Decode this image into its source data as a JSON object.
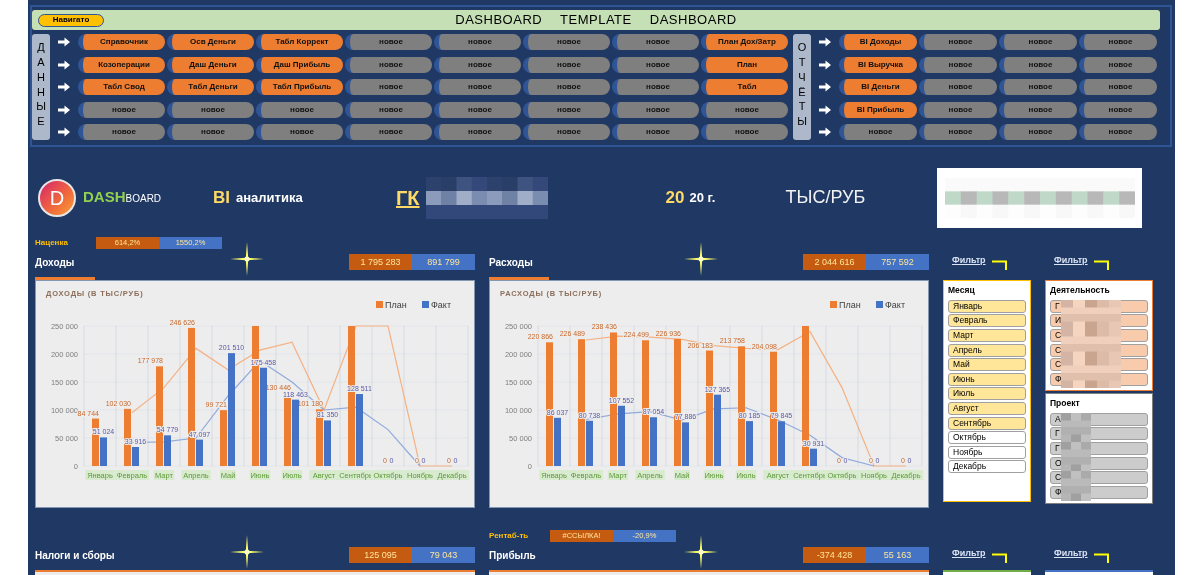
{
  "navigation": {
    "navigator_button": "Навигато",
    "title": "DASHBOARD TEMPLATE DASHBOARD",
    "groups": [
      {
        "label": "ДАННЫЕ",
        "rows": [
          [
            {
              "label": "Справочник",
              "highlighted": true
            },
            {
              "label": "Осв Деньги",
              "highlighted": true
            },
            {
              "label": "Табл Коррект",
              "highlighted": true
            },
            {
              "label": "новое",
              "highlighted": false
            },
            {
              "label": "новое",
              "highlighted": false
            },
            {
              "label": "новое",
              "highlighted": false
            },
            {
              "label": "новое",
              "highlighted": false
            },
            {
              "label": "План Дох/Затр",
              "highlighted": true
            }
          ],
          [
            {
              "label": "Козоперации",
              "highlighted": true
            },
            {
              "label": "Даш Деньги",
              "highlighted": true
            },
            {
              "label": "Даш Прибыль",
              "highlighted": true
            },
            {
              "label": "новое",
              "highlighted": false
            },
            {
              "label": "новое",
              "highlighted": false
            },
            {
              "label": "новое",
              "highlighted": false
            },
            {
              "label": "новое",
              "highlighted": false
            },
            {
              "label": "План",
              "highlighted": true
            }
          ],
          [
            {
              "label": "Табл Свод",
              "highlighted": true
            },
            {
              "label": "Табл Деньги",
              "highlighted": true
            },
            {
              "label": "Табл Прибыль",
              "highlighted": true
            },
            {
              "label": "новое",
              "highlighted": false
            },
            {
              "label": "новое",
              "highlighted": false
            },
            {
              "label": "новое",
              "highlighted": false
            },
            {
              "label": "новое",
              "highlighted": false
            },
            {
              "label": "Табл",
              "highlighted": true
            }
          ],
          [
            {
              "label": "новое",
              "highlighted": false
            },
            {
              "label": "новое",
              "highlighted": false
            },
            {
              "label": "новое",
              "highlighted": false
            },
            {
              "label": "новое",
              "highlighted": false
            },
            {
              "label": "новое",
              "highlighted": false
            },
            {
              "label": "новое",
              "highlighted": false
            },
            {
              "label": "новое",
              "highlighted": false
            },
            {
              "label": "новое",
              "highlighted": false
            }
          ],
          [
            {
              "label": "новое",
              "highlighted": false
            },
            {
              "label": "новое",
              "highlighted": false
            },
            {
              "label": "новое",
              "highlighted": false
            },
            {
              "label": "новое",
              "highlighted": false
            },
            {
              "label": "новое",
              "highlighted": false
            },
            {
              "label": "новое",
              "highlighted": false
            },
            {
              "label": "новое",
              "highlighted": false
            },
            {
              "label": "новое",
              "highlighted": false
            }
          ]
        ]
      },
      {
        "label": "ОТЧЁТЫ",
        "rows": [
          [
            {
              "label": "BI Доходы",
              "highlighted": true
            },
            {
              "label": "новое",
              "highlighted": false
            },
            {
              "label": "новое",
              "highlighted": false
            },
            {
              "label": "новое",
              "highlighted": false
            }
          ],
          [
            {
              "label": "BI Выручка",
              "highlighted": true
            },
            {
              "label": "новое",
              "highlighted": false
            },
            {
              "label": "новое",
              "highlighted": false
            },
            {
              "label": "новое",
              "highlighted": false
            }
          ],
          [
            {
              "label": "BI Деньги",
              "highlighted": true
            },
            {
              "label": "новое",
              "highlighted": false
            },
            {
              "label": "новое",
              "highlighted": false
            },
            {
              "label": "новое",
              "highlighted": false
            }
          ],
          [
            {
              "label": "BI Прибыль",
              "highlighted": true
            },
            {
              "label": "новое",
              "highlighted": false
            },
            {
              "label": "новое",
              "highlighted": false
            },
            {
              "label": "новое",
              "highlighted": false
            }
          ],
          [
            {
              "label": "новое",
              "highlighted": false
            },
            {
              "label": "новое",
              "highlighted": false
            },
            {
              "label": "новое",
              "highlighted": false
            },
            {
              "label": "новое",
              "highlighted": false
            }
          ]
        ]
      }
    ]
  },
  "header": {
    "logo_letter": "D",
    "brand_main": "DASH",
    "brand_tail": "BOARD",
    "bi": "BI",
    "bi_text": "аналитика",
    "company": "ГК",
    "year": "20",
    "year_suffix": "20 г.",
    "units": "ТЫС/РУБ"
  },
  "top_row": {
    "panels": [
      {
        "title": "Доходы",
        "metric": {
          "label": "Наценка",
          "plan": "614,2%",
          "fact": "1550,2%"
        },
        "totals": {
          "plan": "1 795 283",
          "fact": "891 799"
        },
        "chart_data": {
          "type": "bar",
          "title": "ДОХОДЫ (В ТЫС/РУБ)",
          "categories": [
            "Январь",
            "Февраль",
            "Март",
            "Апрель",
            "Май",
            "Июнь",
            "Июль",
            "Август",
            "Сентябрь",
            "Октябрь",
            "Ноябрь",
            "Декабрь"
          ],
          "ylim": [
            0,
            250000
          ],
          "yticks": [
            {
              "value": 0,
              "label": "0"
            },
            {
              "value": 50000,
              "label": "50 000"
            },
            {
              "value": 100000,
              "label": "100 000"
            },
            {
              "value": 150000,
              "label": "150 000"
            },
            {
              "value": 200000,
              "label": "200 000"
            },
            {
              "value": 250000,
              "label": "250 000"
            }
          ],
          "grid": true,
          "legend": "top-right",
          "series": [
            {
              "name": "План",
              "color": "#ed7d31",
              "values": [
                84744,
                102030,
                177978,
                246626,
                99721,
                250000,
                130446,
                101180,
                250000,
                0,
                0,
                0
              ]
            },
            {
              "name": "Факт",
              "color": "#4472c4",
              "values": [
                51024,
                33916,
                54779,
                47097,
                201510,
                175458,
                118463,
                81350,
                128511,
                0,
                0,
                0
              ]
            },
            {
              "type": "line",
              "color": "#f4b183",
              "values": [
                null,
                95000,
                140000,
                210000,
                172000,
                207000,
                221000,
                100000,
                250000,
                250000,
                0,
                0
              ]
            },
            {
              "type": "line",
              "color": "#8faadc",
              "values": [
                null,
                42000,
                43000,
                50000,
                125000,
                188000,
                150000,
                100000,
                105000,
                65000,
                0,
                null
              ]
            }
          ],
          "value_labels": [
            [
              "84 744",
              "102 030",
              "177 978",
              "246 626",
              "99 721",
              null,
              "130 446",
              "101 180",
              null,
              "0",
              "0",
              "0"
            ],
            [
              "51 024",
              "33 916",
              "54 779",
              "47 097",
              "201 510",
              "175 458",
              "118 463",
              "81 350",
              "128 511",
              "0",
              "0",
              "0"
            ],
            null,
            null
          ]
        }
      },
      {
        "title": "Расходы",
        "totals": {
          "plan": "2 044 616",
          "fact": "757 592"
        },
        "chart_data": {
          "type": "bar",
          "title": "РАСХОДЫ (В ТЫС/РУБ)",
          "categories": [
            "Январь",
            "Февраль",
            "Март",
            "Апрель",
            "Май",
            "Июнь",
            "Июль",
            "Август",
            "Сентябрь",
            "Октябрь",
            "Ноябрь",
            "Декабрь"
          ],
          "ylim": [
            0,
            250000
          ],
          "yticks": [
            {
              "value": 0,
              "label": "0"
            },
            {
              "value": 50000,
              "label": "50 000"
            },
            {
              "value": 100000,
              "label": "100 000"
            },
            {
              "value": 150000,
              "label": "150 000"
            },
            {
              "value": 200000,
              "label": "200 000"
            },
            {
              "value": 250000,
              "label": "250 000"
            }
          ],
          "grid": true,
          "legend": "top-right",
          "series": [
            {
              "name": "План",
              "color": "#ed7d31",
              "values": [
                220866,
                226489,
                238436,
                224499,
                226936,
                206183,
                213758,
                204098,
                250000,
                0,
                0,
                0
              ]
            },
            {
              "name": "Факт",
              "color": "#4472c4",
              "values": [
                86037,
                80738,
                107552,
                87054,
                77886,
                127365,
                80185,
                79845,
                30931,
                0,
                0,
                0
              ]
            },
            {
              "type": "line",
              "color": "#f4b183",
              "values": [
                null,
                225000,
                232000,
                230000,
                226000,
                215000,
                210000,
                208000,
                240000,
                140000,
                0,
                0
              ]
            },
            {
              "type": "line",
              "color": "#8faadc",
              "values": [
                null,
                83000,
                93000,
                97000,
                82000,
                102000,
                104000,
                82000,
                55000,
                15000,
                0,
                null
              ]
            }
          ],
          "value_labels": [
            [
              "220 866",
              "226 489",
              "238 436",
              "224 499",
              "226 936",
              "206 183",
              "213 758",
              "204 098",
              null,
              "0",
              "0",
              "0"
            ],
            [
              "86 037",
              "80 738",
              "107 552",
              "87 054",
              "77 886",
              "127 365",
              "80 185",
              "79 845",
              "30 931",
              "0",
              "0",
              "0"
            ],
            null,
            null
          ]
        }
      }
    ],
    "filters": [
      {
        "link": "Фильтр"
      },
      {
        "link": "Фильтр"
      }
    ]
  },
  "slicers": [
    {
      "title": "Месяц",
      "color": "#ffc000",
      "redacted": false,
      "items": [
        {
          "label": "Январь",
          "selected": true
        },
        {
          "label": "Февраль",
          "selected": true
        },
        {
          "label": "Март",
          "selected": true
        },
        {
          "label": "Апрель",
          "selected": true
        },
        {
          "label": "Май",
          "selected": true
        },
        {
          "label": "Июнь",
          "selected": true
        },
        {
          "label": "Июль",
          "selected": true
        },
        {
          "label": "Август",
          "selected": true
        },
        {
          "label": "Сентябрь",
          "selected": true
        },
        {
          "label": "Октябрь",
          "selected": false
        },
        {
          "label": "Ноябрь",
          "selected": false
        },
        {
          "label": "Декабрь",
          "selected": false
        }
      ]
    },
    {
      "title": "Деятельность",
      "color": "#ed7d31",
      "redacted": true,
      "items": [
        {
          "label": "Г",
          "selected": true
        },
        {
          "label": "И",
          "selected": true
        },
        {
          "label": "С",
          "selected": true
        },
        {
          "label": "С",
          "selected": true
        },
        {
          "label": "С",
          "selected": true
        },
        {
          "label": "Ф",
          "selected": true
        }
      ]
    },
    {
      "title": "Проект",
      "color": "#7f7f7f",
      "redacted": true,
      "items": [
        {
          "label": "А",
          "selected": true
        },
        {
          "label": "Г",
          "selected": true
        },
        {
          "label": "Г",
          "selected": true
        },
        {
          "label": "О",
          "selected": true
        },
        {
          "label": "С",
          "selected": true
        },
        {
          "label": "Ф",
          "selected": true
        }
      ]
    }
  ],
  "bottom_row": {
    "panels": [
      {
        "title": "Налоги и сборы",
        "totals": {
          "plan": "125 095",
          "fact": "79 043"
        }
      },
      {
        "title": "Прибыль",
        "metric": {
          "label": "Рентаб-ть",
          "plan": "#ССЫЛКА!",
          "fact": "-20,9%"
        },
        "totals": {
          "plan": "-374 428",
          "fact": "55 163"
        }
      }
    ],
    "filters": [
      {
        "link": "Фильтр"
      },
      {
        "link": "Фильтр"
      }
    ]
  }
}
